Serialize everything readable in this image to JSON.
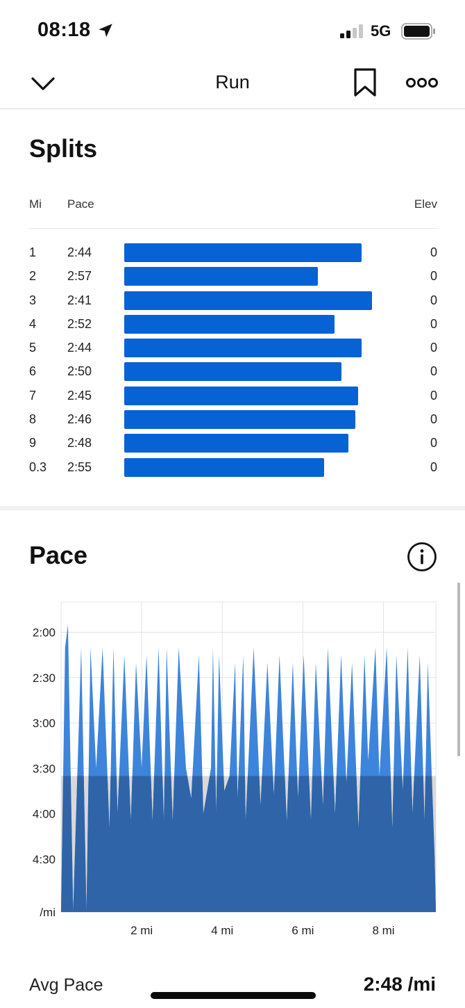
{
  "status": {
    "time": "08:18",
    "network": "5G"
  },
  "nav": {
    "title": "Run"
  },
  "splits": {
    "title": "Splits",
    "headers": {
      "mi": "Mi",
      "pace": "Pace",
      "elev": "Elev"
    },
    "rows": [
      {
        "mi": "1",
        "pace": "2:44",
        "elev": "0"
      },
      {
        "mi": "2",
        "pace": "2:57",
        "elev": "0"
      },
      {
        "mi": "3",
        "pace": "2:41",
        "elev": "0"
      },
      {
        "mi": "4",
        "pace": "2:52",
        "elev": "0"
      },
      {
        "mi": "5",
        "pace": "2:44",
        "elev": "0"
      },
      {
        "mi": "6",
        "pace": "2:50",
        "elev": "0"
      },
      {
        "mi": "7",
        "pace": "2:45",
        "elev": "0"
      },
      {
        "mi": "8",
        "pace": "2:46",
        "elev": "0"
      },
      {
        "mi": "9",
        "pace": "2:48",
        "elev": "0"
      },
      {
        "mi": "0.3",
        "pace": "2:55",
        "elev": "0"
      }
    ],
    "bar_color": "#0762d4"
  },
  "pace": {
    "title": "Pace"
  },
  "summary": {
    "avg_pace_label": "Avg Pace",
    "avg_pace_value": "2:48 /mi"
  },
  "chart_data": {
    "type": "area",
    "title": "",
    "xlabel": "",
    "ylabel": "",
    "y_unit_label": "/mi",
    "y_tick_labels": [
      "2:00",
      "2:30",
      "3:00",
      "3:30",
      "4:00",
      "4:30",
      "/mi"
    ],
    "y_ticks_seconds": [
      120,
      150,
      180,
      210,
      240,
      270
    ],
    "ylim_seconds": [
      100,
      305
    ],
    "y_inverted": true,
    "x_tick_labels": [
      "2 mi",
      "4 mi",
      "6 mi",
      "8 mi"
    ],
    "x_ticks_miles": [
      2,
      4,
      6,
      8
    ],
    "xlim_miles": [
      0,
      9.3
    ],
    "avg_band_seconds": 215,
    "series_color": "#3d84db",
    "avg_overlay_color": "#2f64a8",
    "series": [
      {
        "x": [
          0.0,
          0.1,
          0.17,
          0.3,
          0.5,
          0.63,
          0.73,
          0.87,
          1.03,
          1.2,
          1.3,
          1.4,
          1.57,
          1.73,
          1.86,
          2.0,
          2.12,
          2.27,
          2.42,
          2.55,
          2.62,
          2.77,
          2.92,
          3.1,
          3.23,
          3.42,
          3.53,
          3.72,
          3.77,
          3.85,
          3.92,
          4.05,
          4.18,
          4.32,
          4.38,
          4.52,
          4.58,
          4.78,
          4.95,
          5.12,
          5.28,
          5.42,
          5.6,
          5.75,
          5.88,
          6.02,
          6.2,
          6.32,
          6.5,
          6.62,
          6.8,
          6.95,
          7.08,
          7.22,
          7.38,
          7.53,
          7.62,
          7.8,
          7.9,
          8.08,
          8.22,
          8.32,
          8.48,
          8.6,
          8.72,
          8.9,
          9.02,
          9.1,
          9.27,
          9.3
        ],
        "y": [
          305,
          130,
          115,
          305,
          130,
          305,
          130,
          210,
          130,
          250,
          130,
          240,
          135,
          245,
          140,
          210,
          135,
          245,
          130,
          245,
          130,
          245,
          130,
          210,
          230,
          135,
          240,
          210,
          130,
          240,
          135,
          225,
          215,
          140,
          230,
          135,
          245,
          130,
          235,
          140,
          228,
          135,
          245,
          140,
          230,
          135,
          245,
          140,
          235,
          130,
          240,
          135,
          220,
          140,
          250,
          135,
          205,
          130,
          215,
          130,
          250,
          135,
          225,
          130,
          240,
          135,
          245,
          140,
          270,
          305
        ]
      }
    ]
  }
}
